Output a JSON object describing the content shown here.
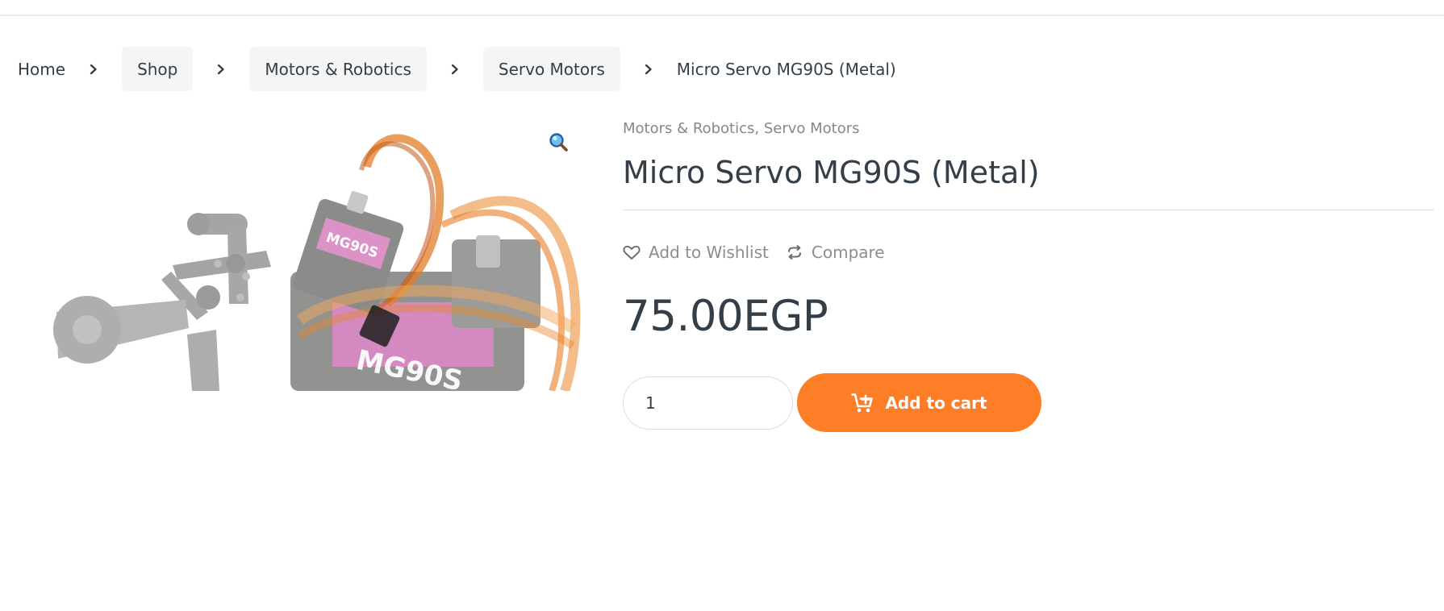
{
  "breadcrumb": {
    "items": [
      {
        "label": "Home"
      },
      {
        "label": "Shop"
      },
      {
        "label": "Motors & Robotics"
      },
      {
        "label": "Servo Motors"
      }
    ],
    "current": "Micro Servo MG90S (Metal)"
  },
  "gallery": {
    "image_label_main": "MG90S",
    "image_label_small": "MG90S",
    "zoom_icon": "magnifier-icon"
  },
  "product": {
    "categories": [
      "Motors & Robotics",
      "Servo Motors"
    ],
    "category_separator": ", ",
    "title": "Micro Servo MG90S (Metal)",
    "wishlist_label": "Add to Wishlist",
    "compare_label": "Compare",
    "price": "75.00EGP",
    "quantity": "1",
    "add_to_cart_label": "Add to cart"
  },
  "colors": {
    "accent": "#fe7e28",
    "text": "#333e48",
    "muted": "#878787"
  }
}
